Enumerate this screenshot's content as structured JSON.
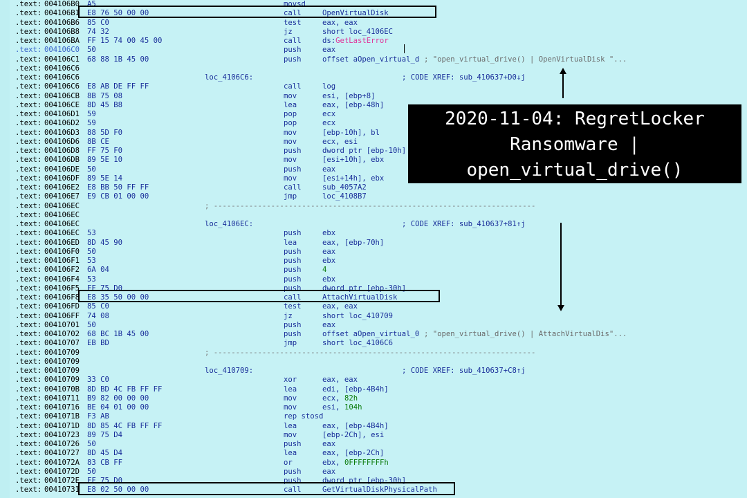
{
  "callout": {
    "line1": "2020-11-04: RegretLocker",
    "line2": "Ransomware |",
    "line3": "open_virtual_drive()"
  },
  "lines": [
    {
      "seg": ".text:",
      "addr": "004106B0",
      "bytes": "A5",
      "mnem": "movsd"
    },
    {
      "seg": ".text:",
      "addr": "004106B1",
      "bytes": "E8 76 50 00 00",
      "mnem": "call",
      "api": "OpenVirtualDisk"
    },
    {
      "seg": ".text:",
      "addr": "004106B6",
      "bytes": "85 C0",
      "mnem": "test",
      "ops": "eax, eax"
    },
    {
      "seg": ".text:",
      "addr": "004106B8",
      "bytes": "74 32",
      "mnem": "jz",
      "ops": "short loc_4106EC"
    },
    {
      "seg": ".text:",
      "addr": "004106BA",
      "bytes": "FF 15 74 00 45 00",
      "mnem": "call",
      "ops": "ds:",
      "err": "GetLastError"
    },
    {
      "seg": ".text:",
      "addr": "004106C0",
      "bytes": "50",
      "mnem": "push",
      "ops": "eax",
      "dim": true
    },
    {
      "seg": ".text:",
      "addr": "004106C1",
      "bytes": "68 88 1B 45 00",
      "mnem": "push",
      "ops": "offset aOpen_virtual_d",
      "cmt": "; \"open_virtual_drive() | OpenVirtualDisk \"..."
    },
    {
      "seg": ".text:",
      "addr": "004106C6"
    },
    {
      "seg": ".text:",
      "addr": "004106C6",
      "label": "loc_4106C6:",
      "xref": "; CODE XREF: sub_410637+D0↓j"
    },
    {
      "seg": ".text:",
      "addr": "004106C6",
      "bytes": "E8 AB DE FF FF",
      "mnem": "call",
      "ops": "log"
    },
    {
      "seg": ".text:",
      "addr": "004106CB",
      "bytes": "8B 75 08",
      "mnem": "mov",
      "ops": "esi, [ebp+8]"
    },
    {
      "seg": ".text:",
      "addr": "004106CE",
      "bytes": "8D 45 B8",
      "mnem": "lea",
      "ops": "eax, [ebp-48h]"
    },
    {
      "seg": ".text:",
      "addr": "004106D1",
      "bytes": "59",
      "mnem": "pop",
      "ops": "ecx"
    },
    {
      "seg": ".text:",
      "addr": "004106D2",
      "bytes": "59",
      "mnem": "pop",
      "ops": "ecx"
    },
    {
      "seg": ".text:",
      "addr": "004106D3",
      "bytes": "88 5D F0",
      "mnem": "mov",
      "ops": "[ebp-10h], bl"
    },
    {
      "seg": ".text:",
      "addr": "004106D6",
      "bytes": "8B CE",
      "mnem": "mov",
      "ops": "ecx, esi"
    },
    {
      "seg": ".text:",
      "addr": "004106D8",
      "bytes": "FF 75 F0",
      "mnem": "push",
      "ops": "dword ptr [ebp-10h]"
    },
    {
      "seg": ".text:",
      "addr": "004106DB",
      "bytes": "89 5E 10",
      "mnem": "mov",
      "ops": "[esi+10h], ebx"
    },
    {
      "seg": ".text:",
      "addr": "004106DE",
      "bytes": "50",
      "mnem": "push",
      "ops": "eax"
    },
    {
      "seg": ".text:",
      "addr": "004106DF",
      "bytes": "89 5E 14",
      "mnem": "mov",
      "ops": "[esi+14h], ebx"
    },
    {
      "seg": ".text:",
      "addr": "004106E2",
      "bytes": "E8 BB 50 FF FF",
      "mnem": "call",
      "ops": "sub_4057A2"
    },
    {
      "seg": ".text:",
      "addr": "004106E7",
      "bytes": "E9 CB 01 00 00",
      "mnem": "jmp",
      "ops": "loc_4108B7"
    },
    {
      "seg": ".text:",
      "addr": "004106EC",
      "sep": "; -------------------------------------------------------------------------"
    },
    {
      "seg": ".text:",
      "addr": "004106EC"
    },
    {
      "seg": ".text:",
      "addr": "004106EC",
      "label": "loc_4106EC:",
      "xref": "; CODE XREF: sub_410637+81↑j"
    },
    {
      "seg": ".text:",
      "addr": "004106EC",
      "bytes": "53",
      "mnem": "push",
      "ops": "ebx"
    },
    {
      "seg": ".text:",
      "addr": "004106ED",
      "bytes": "8D 45 90",
      "mnem": "lea",
      "ops": "eax, [ebp-70h]"
    },
    {
      "seg": ".text:",
      "addr": "004106F0",
      "bytes": "50",
      "mnem": "push",
      "ops": "eax"
    },
    {
      "seg": ".text:",
      "addr": "004106F1",
      "bytes": "53",
      "mnem": "push",
      "ops": "ebx"
    },
    {
      "seg": ".text:",
      "addr": "004106F2",
      "bytes": "6A 04",
      "mnem": "push",
      "num": "4"
    },
    {
      "seg": ".text:",
      "addr": "004106F4",
      "bytes": "53",
      "mnem": "push",
      "ops": "ebx"
    },
    {
      "seg": ".text:",
      "addr": "004106F5",
      "bytes": "FF 75 D0",
      "mnem": "push",
      "ops": "dword ptr [ebp-30h]"
    },
    {
      "seg": ".text:",
      "addr": "004106F8",
      "bytes": "E8 35 50 00 00",
      "mnem": "call",
      "api": "AttachVirtualDisk"
    },
    {
      "seg": ".text:",
      "addr": "004106FD",
      "bytes": "85 C0",
      "mnem": "test",
      "ops": "eax, eax"
    },
    {
      "seg": ".text:",
      "addr": "004106FF",
      "bytes": "74 08",
      "mnem": "jz",
      "ops": "short loc_410709"
    },
    {
      "seg": ".text:",
      "addr": "00410701",
      "bytes": "50",
      "mnem": "push",
      "ops": "eax"
    },
    {
      "seg": ".text:",
      "addr": "00410702",
      "bytes": "68 BC 1B 45 00",
      "mnem": "push",
      "ops": "offset aOpen_virtual_0",
      "cmt": "; \"open_virtual_drive() | AttachVirtualDis\"..."
    },
    {
      "seg": ".text:",
      "addr": "00410707",
      "bytes": "EB BD",
      "mnem": "jmp",
      "ops": "short loc_4106C6"
    },
    {
      "seg": ".text:",
      "addr": "00410709",
      "sep": "; -------------------------------------------------------------------------"
    },
    {
      "seg": ".text:",
      "addr": "00410709"
    },
    {
      "seg": ".text:",
      "addr": "00410709",
      "label": "loc_410709:",
      "xref": "; CODE XREF: sub_410637+C8↑j"
    },
    {
      "seg": ".text:",
      "addr": "00410709",
      "bytes": "33 C0",
      "mnem": "xor",
      "ops": "eax, eax"
    },
    {
      "seg": ".text:",
      "addr": "0041070B",
      "bytes": "8D BD 4C FB FF FF",
      "mnem": "lea",
      "ops": "edi, [ebp-4B4h]"
    },
    {
      "seg": ".text:",
      "addr": "00410711",
      "bytes": "B9 82 00 00 00",
      "mnem": "mov",
      "ops": "ecx, ",
      "num": "82h"
    },
    {
      "seg": ".text:",
      "addr": "00410716",
      "bytes": "BE 04 01 00 00",
      "mnem": "mov",
      "ops": "esi, ",
      "num": "104h"
    },
    {
      "seg": ".text:",
      "addr": "0041071B",
      "bytes": "F3 AB",
      "mnem": "rep stosd"
    },
    {
      "seg": ".text:",
      "addr": "0041071D",
      "bytes": "8D 85 4C FB FF FF",
      "mnem": "lea",
      "ops": "eax, [ebp-4B4h]"
    },
    {
      "seg": ".text:",
      "addr": "00410723",
      "bytes": "89 75 D4",
      "mnem": "mov",
      "ops": "[ebp-2Ch], esi"
    },
    {
      "seg": ".text:",
      "addr": "00410726",
      "bytes": "50",
      "mnem": "push",
      "ops": "eax"
    },
    {
      "seg": ".text:",
      "addr": "00410727",
      "bytes": "8D 45 D4",
      "mnem": "lea",
      "ops": "eax, [ebp-2Ch]"
    },
    {
      "seg": ".text:",
      "addr": "0041072A",
      "bytes": "83 CB FF",
      "mnem": "or",
      "ops": "ebx, ",
      "num": "0FFFFFFFFh"
    },
    {
      "seg": ".text:",
      "addr": "0041072D",
      "bytes": "50",
      "mnem": "push",
      "ops": "eax"
    },
    {
      "seg": ".text:",
      "addr": "0041072E",
      "bytes": "FF 75 D0",
      "mnem": "push",
      "ops": "dword ptr [ebp-30h]"
    },
    {
      "seg": ".text:",
      "addr": "00410731",
      "bytes": "E8 02 50 00 00",
      "mnem": "call",
      "api": "GetVirtualDiskPhysicalPath"
    }
  ]
}
